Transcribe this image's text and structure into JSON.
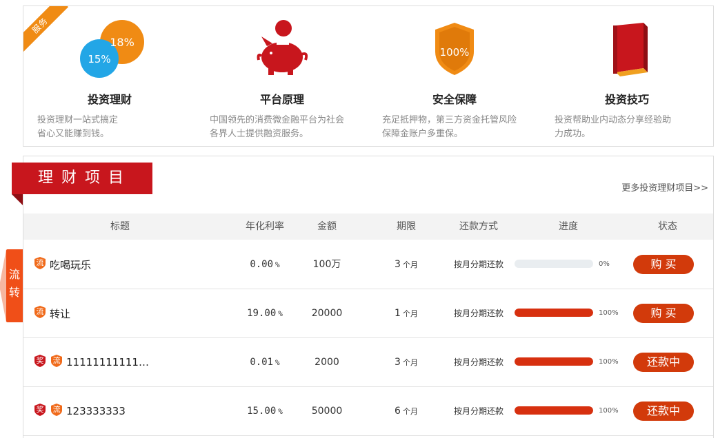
{
  "services": {
    "ribbon_label": "服务",
    "icon_texts": {
      "rate_a": "15%",
      "rate_b": "18%",
      "shield": "100%"
    },
    "items": [
      {
        "icon": "percentage-bubbles-icon",
        "title": "投资理财",
        "desc_line1": "投资理财一站式搞定",
        "desc_line2": "省心又能赚到钱。"
      },
      {
        "icon": "piggy-bank-icon",
        "title": "平台原理",
        "desc_line1": "中国领先的消费微金融平台为社会",
        "desc_line2": "各界人士提供融资服务。"
      },
      {
        "icon": "shield-icon",
        "title": "安全保障",
        "desc_line1": "充足抵押物，第三方资金托管风险",
        "desc_line2": "保障金账户多重保。"
      },
      {
        "icon": "book-icon",
        "title": "投资技巧",
        "desc_line1": "投资帮助业内动态分享经验助",
        "desc_line2": "力成功。"
      }
    ]
  },
  "projects": {
    "section_title": "理财项目",
    "more_link": "更多投资理财项目>>",
    "side_tab": {
      "line1": "流",
      "line2": "转"
    },
    "columns": [
      "标题",
      "年化利率",
      "金额",
      "期限",
      "还款方式",
      "进度",
      "状态"
    ],
    "rows": [
      {
        "badges": [
          "流"
        ],
        "title": "吃喝玩乐",
        "rate": "0.00",
        "rate_unit": "%",
        "amount": "100万",
        "term": "3",
        "term_unit": "个月",
        "repay": "按月分期还款",
        "progress": 0,
        "progress_label": "0%",
        "action": "购 买"
      },
      {
        "badges": [
          "流"
        ],
        "title": "转让",
        "rate": "19.00",
        "rate_unit": "%",
        "amount": "20000",
        "term": "1",
        "term_unit": "个月",
        "repay": "按月分期还款",
        "progress": 100,
        "progress_label": "100%",
        "action": "购 买"
      },
      {
        "badges": [
          "奖",
          "流"
        ],
        "title": "11111111111…",
        "rate": "0.01",
        "rate_unit": "%",
        "amount": "2000",
        "term": "3",
        "term_unit": "个月",
        "repay": "按月分期还款",
        "progress": 100,
        "progress_label": "100%",
        "action": "还款中"
      },
      {
        "badges": [
          "奖",
          "流"
        ],
        "title": "123333333",
        "rate": "15.00",
        "rate_unit": "%",
        "amount": "50000",
        "term": "6",
        "term_unit": "个月",
        "repay": "按月分期还款",
        "progress": 100,
        "progress_label": "100%",
        "action": "还款中"
      }
    ]
  },
  "colors": {
    "brand_red": "#c8161d",
    "accent_orange": "#f08b14",
    "button_red": "#d23a0b",
    "progress_red": "#d7300f",
    "badge_orange": "#f06a1a",
    "badge_red": "#c8161d"
  }
}
